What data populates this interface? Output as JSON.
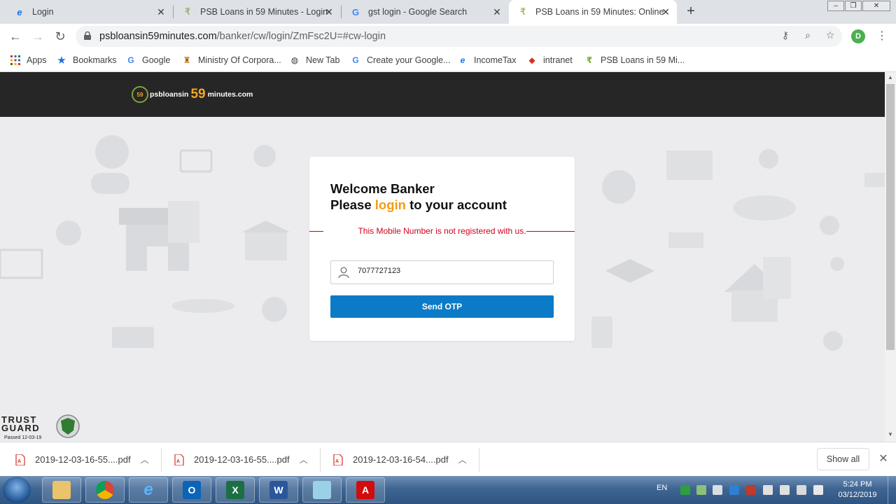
{
  "tabs": [
    {
      "title": "Login",
      "icon": "ie-icon",
      "active": false
    },
    {
      "title": "PSB Loans in 59 Minutes - Login",
      "icon": "psb-icon",
      "active": false
    },
    {
      "title": "gst login - Google Search",
      "icon": "google-icon",
      "active": false
    },
    {
      "title": "PSB Loans in 59 Minutes: Online",
      "icon": "psb-icon",
      "active": true
    }
  ],
  "address_bar": {
    "domain": "psbloansin59minutes.com",
    "path": "/banker/cw/login/ZmFsc2U=#cw-login"
  },
  "profile_initial": "D",
  "bookmarks": [
    {
      "label": "Apps",
      "icon": "apps-grid-icon"
    },
    {
      "label": "Bookmarks",
      "icon": "star-icon"
    },
    {
      "label": "Google",
      "icon": "google-icon"
    },
    {
      "label": "Ministry Of Corpora...",
      "icon": "emblem-icon"
    },
    {
      "label": "New Tab",
      "icon": "globe-icon"
    },
    {
      "label": "Create your Google...",
      "icon": "google-icon"
    },
    {
      "label": "IncomeTax",
      "icon": "ie-icon"
    },
    {
      "label": "intranet",
      "icon": "bank-icon"
    },
    {
      "label": "PSB Loans in 59 Mi...",
      "icon": "psb-icon"
    }
  ],
  "site": {
    "logo": {
      "text1": "psbloansin",
      "number": "59",
      "text2": "minutes.com",
      "badge": "59"
    }
  },
  "login": {
    "line1": "Welcome Banker",
    "line2_pre": "Please ",
    "line2_highlight": "login",
    "line2_post": " to your account",
    "error": "This Mobile Number is not registered with us.",
    "mobile_value": "7077727123",
    "button": "Send OTP"
  },
  "trust_guard": {
    "line1": "TRUST",
    "line2": "GUARD",
    "passed": "Passed 12-03-19"
  },
  "downloads": [
    {
      "name": "2019-12-03-16-55....pdf"
    },
    {
      "name": "2019-12-03-16-55....pdf"
    },
    {
      "name": "2019-12-03-16-54....pdf"
    }
  ],
  "downloads_show_all": "Show all",
  "taskbar": {
    "apps": [
      "explorer-icon",
      "chrome-icon",
      "ie-icon",
      "outlook-icon",
      "excel-icon",
      "word-icon",
      "notepad-icon",
      "acrobat-icon"
    ],
    "lang": "EN",
    "time": "5:24 PM",
    "date": "03/12/2019"
  },
  "colors": {
    "header": "#262626",
    "accent_orange": "#f39c12",
    "button_blue": "#0b7bc7",
    "error_red": "#d0021b"
  }
}
